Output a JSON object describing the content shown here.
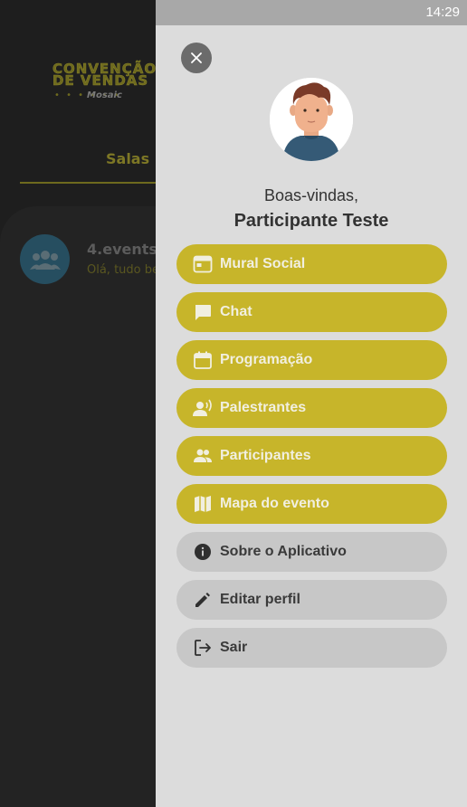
{
  "status_bar": {
    "time": "14:29"
  },
  "background": {
    "logo_line1": "CONVENÇÃO",
    "logo_line2": "DE VENDAS",
    "logo_dots": "• • •          • • •",
    "logo_brand": "Mosaic",
    "tab_label": "Salas",
    "chat_title": "4.events",
    "chat_preview": "Olá, tudo be"
  },
  "drawer": {
    "welcome": "Boas-vindas,",
    "user_name": "Participante Teste",
    "menu": [
      {
        "label": "Mural Social",
        "icon": "mural-icon",
        "style": "primary"
      },
      {
        "label": "Chat",
        "icon": "chat-icon",
        "style": "primary"
      },
      {
        "label": "Programação",
        "icon": "calendar-icon",
        "style": "primary"
      },
      {
        "label": "Palestrantes",
        "icon": "speaker-icon",
        "style": "primary"
      },
      {
        "label": "Participantes",
        "icon": "people-icon",
        "style": "primary"
      },
      {
        "label": "Mapa do evento",
        "icon": "map-icon",
        "style": "primary"
      },
      {
        "label": "Sobre o Aplicativo",
        "icon": "info-icon",
        "style": "secondary"
      },
      {
        "label": "Editar perfil",
        "icon": "edit-icon",
        "style": "secondary"
      },
      {
        "label": "Sair",
        "icon": "logout-icon",
        "style": "secondary"
      }
    ]
  },
  "colors": {
    "accent": "#c7b52a",
    "drawer_bg": "#dcdcdc",
    "secondary_button": "#c7c7c7"
  }
}
